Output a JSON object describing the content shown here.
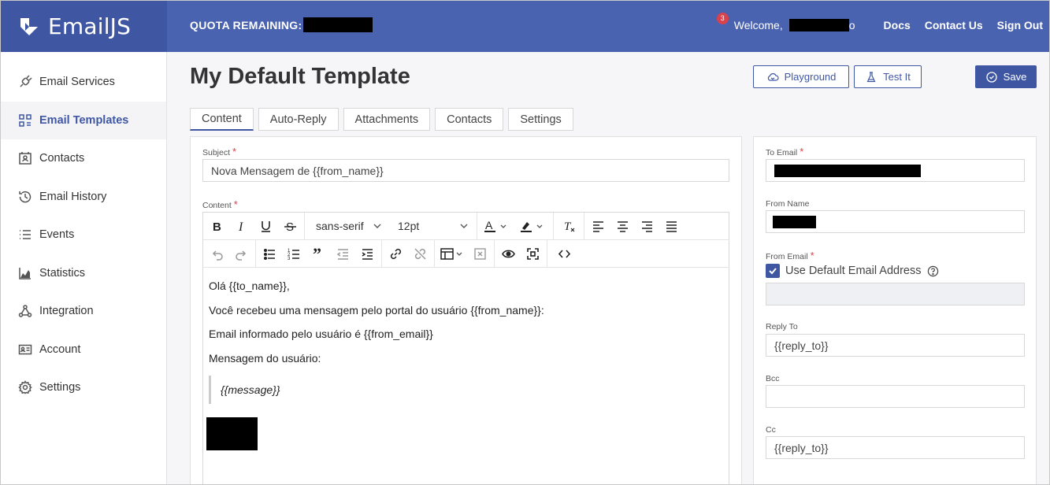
{
  "header": {
    "logo_text": "EmailJS",
    "quota_label": "QUOTA REMAINING:",
    "notification_count": "3",
    "welcome_label": "Welcome,",
    "welcome_tail": "o",
    "links": [
      "Docs",
      "Contact Us",
      "Sign Out"
    ]
  },
  "sidebar": {
    "items": [
      {
        "label": "Email Services",
        "icon": "plug-icon"
      },
      {
        "label": "Email Templates",
        "icon": "templates-icon",
        "active": true
      },
      {
        "label": "Contacts",
        "icon": "contacts-icon"
      },
      {
        "label": "Email History",
        "icon": "history-icon"
      },
      {
        "label": "Events",
        "icon": "list-icon"
      },
      {
        "label": "Statistics",
        "icon": "chart-icon"
      },
      {
        "label": "Integration",
        "icon": "integration-icon"
      },
      {
        "label": "Account",
        "icon": "account-icon"
      },
      {
        "label": "Settings",
        "icon": "gear-icon"
      }
    ]
  },
  "page": {
    "title": "My Default Template",
    "playground_label": "Playground",
    "testit_label": "Test It",
    "save_label": "Save"
  },
  "tabs": [
    "Content",
    "Auto-Reply",
    "Attachments",
    "Contacts",
    "Settings"
  ],
  "form": {
    "subject_label": "Subject",
    "subject_value": "Nova Mensagem de {{from_name}}",
    "content_label": "Content",
    "font_family": "sans-serif",
    "font_size": "12pt",
    "content_lines": [
      "Olá {{to_name}},",
      "Você recebeu uma mensagem pelo portal do usuário {{from_name}}:",
      "Email informado pelo usuário é {{from_email}}",
      "Mensagem do usuário:"
    ],
    "quote": "{{message}}"
  },
  "right": {
    "to_email_label": "To Email",
    "from_name_label": "From Name",
    "from_email_label": "From Email",
    "use_default_label": "Use Default Email Address",
    "reply_to_label": "Reply To",
    "reply_to_value": "{{reply_to}}",
    "bcc_label": "Bcc",
    "bcc_value": "",
    "cc_label": "Cc",
    "cc_value": "{{reply_to}}"
  },
  "colors": {
    "brand": "#4a63b0",
    "brand_dark": "#3f57a3",
    "badge": "#d9414d"
  }
}
